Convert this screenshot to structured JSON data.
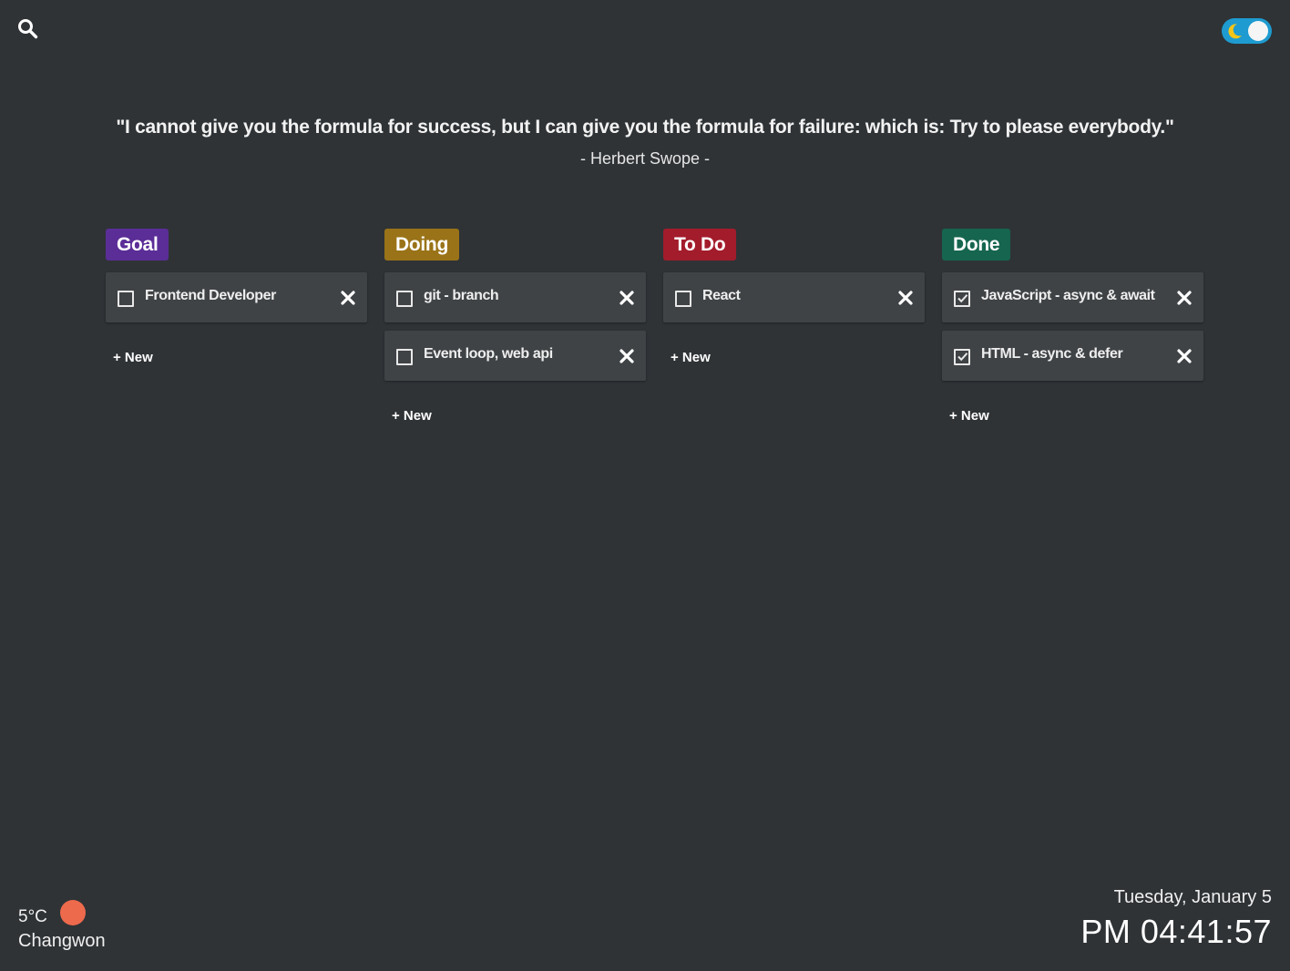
{
  "header": {
    "search_icon": "search-icon",
    "theme_toggle_icon": "moon-icon",
    "theme": "dark"
  },
  "quote": {
    "text": "\"I cannot give you the formula for success, but I can give you the formula for failure: which is: Try to please everybody.\"",
    "author": "- Herbert Swope -"
  },
  "board": {
    "new_label": "+ New",
    "columns": [
      {
        "title": "Goal",
        "color": "#5b2d97",
        "cards": [
          {
            "label": "Frontend Developer",
            "checked": false
          }
        ]
      },
      {
        "title": "Doing",
        "color": "#9a7318",
        "cards": [
          {
            "label": "git - branch",
            "checked": false
          },
          {
            "label": "Event loop, web api",
            "checked": false
          }
        ]
      },
      {
        "title": "To Do",
        "color": "#a31c2b",
        "cards": [
          {
            "label": "React",
            "checked": false
          }
        ]
      },
      {
        "title": "Done",
        "color": "#16654f",
        "cards": [
          {
            "label": "JavaScript - async & await",
            "checked": true
          },
          {
            "label": "HTML - async & defer",
            "checked": true
          }
        ]
      }
    ]
  },
  "weather": {
    "temperature": "5°C",
    "city": "Changwon",
    "icon": "sun-icon",
    "icon_color": "#ee6a4d"
  },
  "clock": {
    "date": "Tuesday, January 5",
    "time": "PM 04:41:57"
  }
}
